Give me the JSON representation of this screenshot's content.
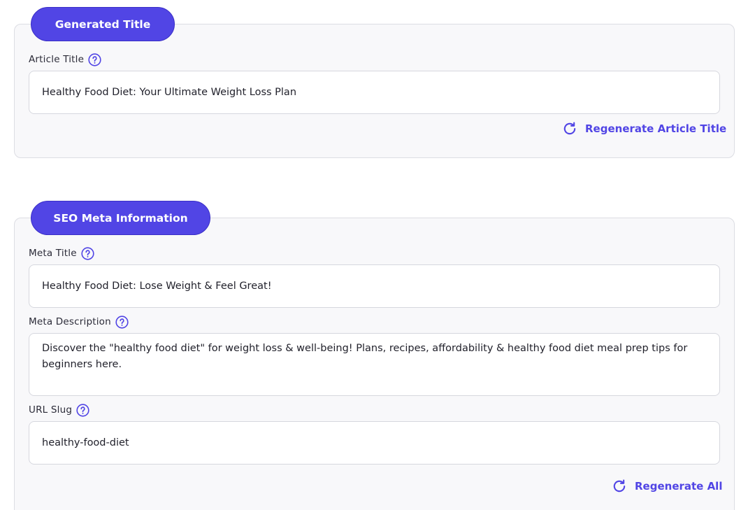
{
  "generated_title_section": {
    "heading": "Generated Title",
    "article_title_label": "Article Title",
    "article_title_value": "Healthy Food Diet: Your Ultimate Weight Loss Plan",
    "regenerate_label": "Regenerate Article Title"
  },
  "seo_section": {
    "heading": "SEO Meta Information",
    "meta_title_label": "Meta Title",
    "meta_title_value": "Healthy Food Diet: Lose Weight & Feel Great!",
    "meta_description_label": "Meta Description",
    "meta_description_value": "Discover the \"healthy food diet\" for weight loss & well-being! Plans, recipes, affordability & healthy food diet meal prep tips for beginners here.",
    "url_slug_label": "URL Slug",
    "url_slug_value": "healthy-food-diet",
    "regenerate_all_label": "Regenerate All"
  },
  "icons": {
    "help": "help-circle-icon",
    "regenerate": "refresh-icon"
  },
  "colors": {
    "accent": "#5145e5",
    "card_bg": "#f8f8fa",
    "border": "#dcdde3"
  }
}
